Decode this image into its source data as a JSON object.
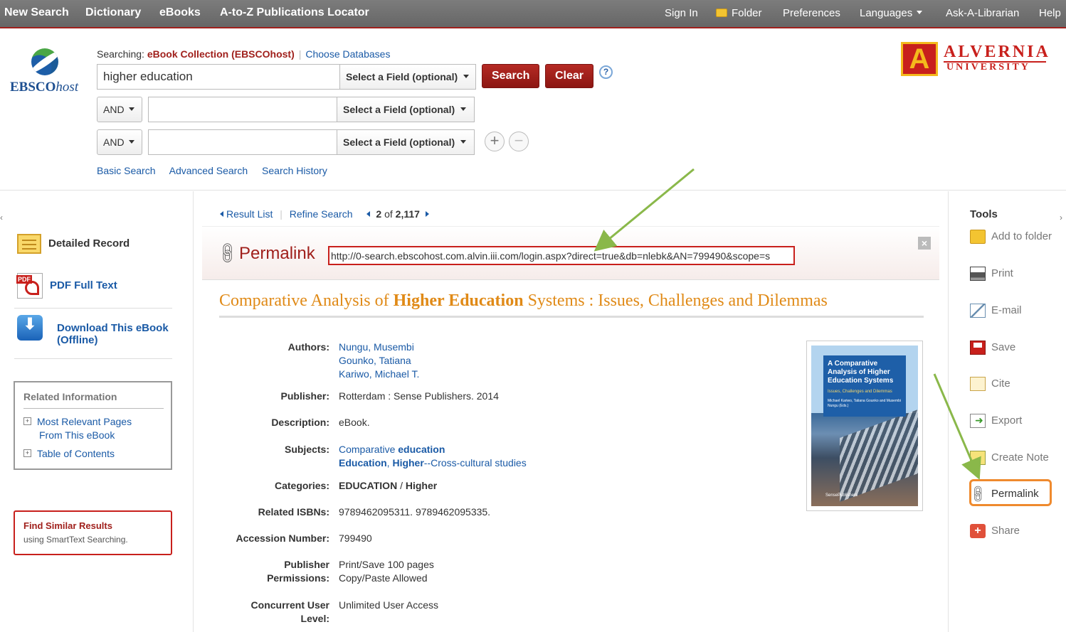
{
  "topbar": {
    "left": [
      "New Search",
      "Dictionary",
      "eBooks",
      "A-to-Z Publications Locator"
    ],
    "sign_in": "Sign In",
    "folder": "Folder",
    "preferences": "Preferences",
    "languages": "Languages",
    "ask": "Ask-A-Librarian",
    "help": "Help"
  },
  "logo": {
    "ebsco": "EBSCO",
    "host": "host"
  },
  "search": {
    "searching_label": "Searching:",
    "database": "eBook Collection (EBSCOhost)",
    "choose_databases": "Choose Databases",
    "query": "higher education",
    "field_placeholder": "Select a Field (optional)",
    "bool_op": "AND",
    "search_btn": "Search",
    "clear_btn": "Clear",
    "help": "?",
    "links": [
      "Basic Search",
      "Advanced Search",
      "Search History"
    ]
  },
  "institution": {
    "name": "ALVERNIA",
    "sub": "UNIVERSITY",
    "mark": "A"
  },
  "left": {
    "formats": [
      {
        "label": "Detailed Record",
        "icon": "detailed-record-icon"
      },
      {
        "label": "PDF Full Text",
        "icon": "pdf-icon"
      },
      {
        "label": "Download This eBook",
        "label2": "(Offline)",
        "icon": "download-icon"
      }
    ],
    "related_title": "Related Information",
    "related_items": [
      "Most Relevant Pages",
      "From This eBook",
      "Table of Contents"
    ],
    "similar_title": "Find Similar Results",
    "similar_sub": "using SmartText Searching."
  },
  "nav": {
    "result_list": "Result List",
    "refine": "Refine Search",
    "position": "2",
    "of": "of",
    "total": "2,117"
  },
  "permalink": {
    "title": "Permalink",
    "url": "http://0-search.ebscohost.com.alvin.iii.com/login.aspx?direct=true&db=nlebk&AN=799490&scope=s",
    "close": "×"
  },
  "record": {
    "title_pre": "Comparative Analysis of ",
    "title_bold": "Higher Education",
    "title_post": " Systems : Issues, Challenges and Dilemmas",
    "labels": {
      "authors": "Authors:",
      "publisher": "Publisher:",
      "description": "Description:",
      "subjects": "Subjects:",
      "categories": "Categories:",
      "isbns": "Related ISBNs:",
      "accession": "Accession Number:",
      "permissions_1": "Publisher",
      "permissions_2": "Permissions:",
      "concurrent_1": "Concurrent User",
      "concurrent_2": "Level:"
    },
    "authors": [
      "Nungu, Musembi",
      "Gounko, Tatiana",
      "Kariwo, Michael T."
    ],
    "publisher": "Rotterdam : Sense Publishers. 2014",
    "description": "eBook.",
    "subject1_pre": "Comparative ",
    "subject1_bold": "education",
    "subject2_b1": "Education",
    "subject2_mid": ", ",
    "subject2_b2": "Higher",
    "subject2_post": "--Cross-cultural studies",
    "category_1": "EDUCATION",
    "category_sep": " / ",
    "category_2": "Higher",
    "isbns": "9789462095311. 9789462095335.",
    "accession": "799490",
    "permissions_1": "Print/Save 100 pages",
    "permissions_2": "Copy/Paste Allowed",
    "concurrent": "Unlimited User Access"
  },
  "cover": {
    "title": "A Comparative Analysis of Higher Education Systems",
    "subtitle": "Issues, Challenges and Dilemmas",
    "authors": "Michael Kariwo, Tatiana Gounko and Musembi Nungu (Eds.)",
    "publisher": "SensePublishers"
  },
  "tools": {
    "title": "Tools",
    "items": [
      {
        "label": "Add to folder",
        "icon": "add-to-folder-icon"
      },
      {
        "label": "Print",
        "icon": "print-icon"
      },
      {
        "label": "E-mail",
        "icon": "email-icon"
      },
      {
        "label": "Save",
        "icon": "save-icon"
      },
      {
        "label": "Cite",
        "icon": "cite-icon"
      },
      {
        "label": "Export",
        "icon": "export-icon"
      },
      {
        "label": "Create Note",
        "icon": "create-note-icon"
      },
      {
        "label": "Permalink",
        "icon": "permalink-icon"
      },
      {
        "label": "Share",
        "icon": "share-icon"
      }
    ]
  },
  "colors": {
    "brand_red": "#a0201c",
    "title_orange": "#e08a17",
    "link_blue": "#1a5aa6",
    "annotation_green": "#8ab84a",
    "highlight_orange": "#ef8a2e"
  }
}
